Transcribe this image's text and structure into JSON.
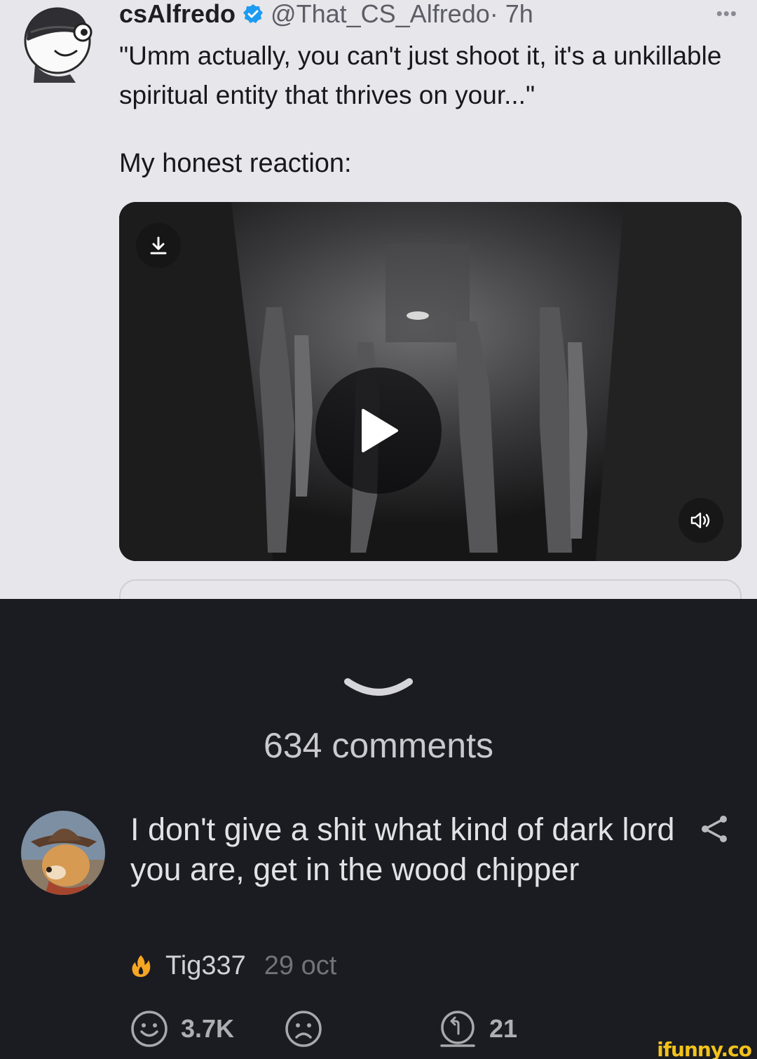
{
  "tweet": {
    "display_name": "csAlfredo",
    "handle": "@That_CS_Alfredo",
    "time": "· 7h",
    "more": "•••",
    "quote": "\"Umm actually, you can't just shoot it, it's a unkillable spiritual entity that thrives on your...\"",
    "reaction_text": "My honest reaction:",
    "badge_color": "#1d9bf0",
    "video": {
      "download_icon": "download-icon",
      "play_icon": "play-icon",
      "volume_icon": "volume-icon"
    }
  },
  "comments_section": {
    "collapse_icon": "chevron-down-icon",
    "count_label": "634 comments"
  },
  "comment": {
    "text": "I don't give a shit what kind of dark lord you are, get in the wood chipper",
    "author": "Tig337",
    "date": "29 oct",
    "author_badge_icon": "fire-icon",
    "share_icon": "share-icon",
    "smile_count": "3.7K",
    "unsmile_icon": "frown-icon",
    "reply_count": "21"
  },
  "watermark": "ifunny.co",
  "colors": {
    "tweet_background": "#e7e6eb",
    "app_background": "#1b1c21",
    "watermark": "#f2c21b",
    "fire": "#f5a623"
  }
}
